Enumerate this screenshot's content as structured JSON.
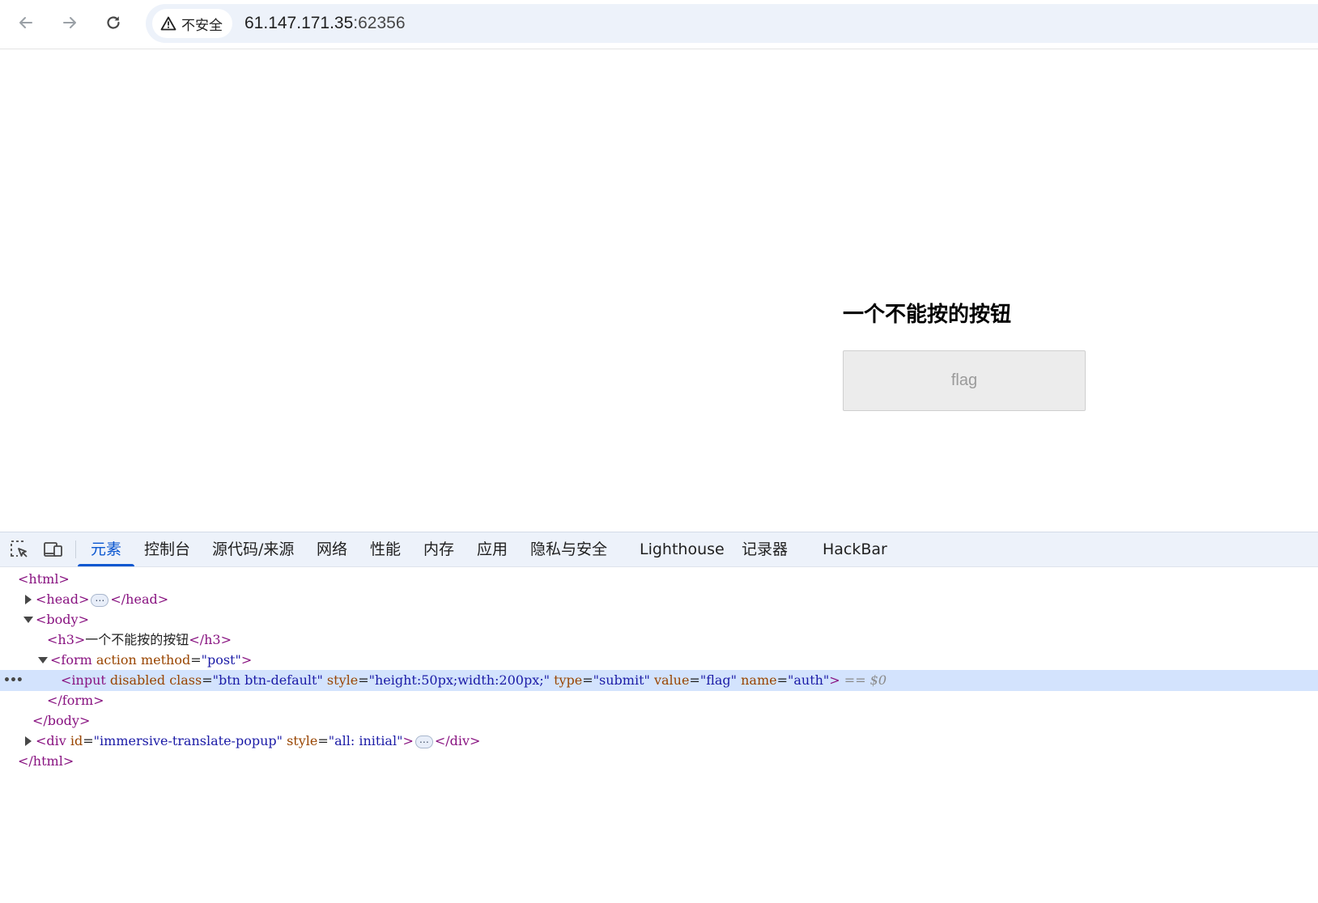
{
  "browser": {
    "security_label": "不安全",
    "url_host": "61.147.171.35",
    "url_port": ":62356"
  },
  "page": {
    "heading": "一个不能按的按钮",
    "button_value": "flag"
  },
  "devtools": {
    "tabs": [
      "元素",
      "控制台",
      "源代码/来源",
      "网络",
      "性能",
      "内存",
      "应用",
      "隐私与安全",
      "Lighthouse",
      "记录器",
      "HackBar"
    ],
    "active_tab": "元素",
    "tree": {
      "html_open": "<html>",
      "head_open": "<head>",
      "head_close": "</head>",
      "body_open": "<body>",
      "h3_open": "<h3>",
      "h3_text": "一个不能按的按钮",
      "h3_close": "</h3>",
      "form_open_tag": "<form",
      "form_attr1": "action",
      "form_attr2": "method",
      "form_attr2_val": "\"post\"",
      "form_close_bracket": ">",
      "input_open": "<input",
      "input_attr_disabled": "disabled",
      "input_attr_class": "class",
      "input_val_class": "\"btn btn-default\"",
      "input_attr_style": "style",
      "input_val_style": "\"height:50px;width:200px;\"",
      "input_attr_type": "type",
      "input_val_type": "\"submit\"",
      "input_attr_value": "value",
      "input_val_value": "\"flag\"",
      "input_attr_name": "name",
      "input_val_name": "\"auth\"",
      "input_close": ">",
      "selected_marker": "== $0",
      "form_close": "</form>",
      "body_close": "</body>",
      "div_open_tag": "<div",
      "div_attr_id": "id",
      "div_val_id": "\"immersive-translate-popup\"",
      "div_attr_style": "style",
      "div_val_style": "\"all: initial\"",
      "div_close_bracket": ">",
      "div_close": "</div>",
      "html_close": "</html>",
      "ellipsis": "…",
      "equals": "=",
      "row_menu": "•••"
    }
  }
}
